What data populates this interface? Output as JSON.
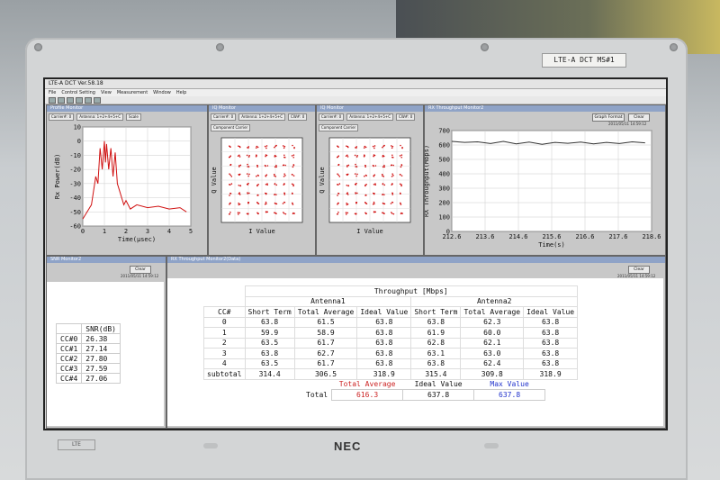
{
  "bezel": {
    "label": "LTE-A DCT MS#1",
    "brand": "NEC",
    "small_label": "LTE"
  },
  "app": {
    "title": "LTE-A DCT Ver.58.18",
    "menu": [
      "File",
      "Control Setting",
      "View",
      "Measurement",
      "Window",
      "Help"
    ]
  },
  "profile_monitor": {
    "title": "Profile Monitor",
    "fields": [
      "Carrier#: 0",
      "Antenna: 1+2+4+5+C",
      "Scale"
    ],
    "chart_data": {
      "type": "line",
      "xlabel": "Time(μsec)",
      "ylabel": "Rx Power(dB)",
      "xlim": [
        0,
        5
      ],
      "ylim": [
        -60,
        10
      ],
      "xticks": [
        "0",
        "1",
        "2",
        "3",
        "4",
        "5"
      ],
      "yticks": [
        "10",
        "0",
        "-10",
        "-20",
        "-30",
        "-40",
        "-50",
        "-60"
      ],
      "x": [
        0.0,
        0.2,
        0.4,
        0.5,
        0.6,
        0.7,
        0.8,
        0.9,
        1.0,
        1.05,
        1.1,
        1.2,
        1.3,
        1.4,
        1.5,
        1.6,
        1.7,
        1.8,
        1.9,
        2.0,
        2.2,
        2.5,
        3.0,
        3.5,
        4.0,
        4.5,
        4.8
      ],
      "y": [
        -55,
        -50,
        -45,
        -35,
        -25,
        -30,
        -5,
        -20,
        0,
        -15,
        -2,
        -20,
        -5,
        -25,
        -8,
        -30,
        -35,
        -40,
        -45,
        -42,
        -48,
        -45,
        -47,
        -46,
        -48,
        -47,
        -50
      ],
      "grid": true
    }
  },
  "iq_monitor_1": {
    "title": "IQ Monitor",
    "fields": [
      "Carrier#: 0",
      "Antenna: 1+2+4+5+C",
      "CW#: 0"
    ],
    "component_label": "Component Carrier",
    "xlabel": "I Value",
    "ylabel": "Q Value"
  },
  "iq_monitor_2": {
    "title": "IQ Monitor",
    "fields": [
      "Carrier#: 0",
      "Antenna: 1+2+4+5+C",
      "CW#: 0"
    ],
    "component_label": "Component Carrier",
    "xlabel": "I Value",
    "ylabel": "Q Value"
  },
  "throughput_monitor": {
    "title": "RX Throughput Monitor2",
    "buttons": [
      "Graph Format",
      "Clear"
    ],
    "date": "2011/05/11 14:59:12",
    "chart_data": {
      "type": "line",
      "xlabel": "Time(s)",
      "ylabel": "RX Throughput(Mbps)",
      "xlim": [
        212.6,
        218.8
      ],
      "ylim": [
        0,
        700
      ],
      "xticks": [
        "212.6",
        "213.6",
        "214.6",
        "215.6",
        "216.6",
        "217.6",
        "218.6"
      ],
      "yticks": [
        "700",
        "600",
        "500",
        "400",
        "300",
        "200",
        "100",
        "0"
      ],
      "x": [
        212.6,
        213.0,
        213.4,
        213.8,
        214.2,
        214.6,
        215.0,
        215.4,
        215.8,
        216.2,
        216.6,
        217.0,
        217.4,
        217.8,
        218.2,
        218.6
      ],
      "y": [
        625,
        618,
        622,
        610,
        625,
        608,
        620,
        605,
        618,
        612,
        620,
        608,
        618,
        610,
        622,
        615
      ],
      "grid": true
    }
  },
  "snr_monitor": {
    "title": "SNR Monitor2",
    "button": "Clear",
    "date": "2011/05/11 14:59:12",
    "header": "SNR(dB)",
    "rows": [
      {
        "cc": "CC#0",
        "value": "26.38"
      },
      {
        "cc": "CC#1",
        "value": "27.14"
      },
      {
        "cc": "CC#2",
        "value": "27.80"
      },
      {
        "cc": "CC#3",
        "value": "27.59"
      },
      {
        "cc": "CC#4",
        "value": "27.06"
      }
    ]
  },
  "throughput_table": {
    "title": "RX Throughput Monitor2(Data)",
    "button": "Clear",
    "date": "2011/05/11 14:59:12",
    "header_main": "Throughput [Mbps]",
    "antenna1": "Antenna1",
    "antenna2": "Antenna2",
    "cc_header": "CC#",
    "cols": [
      "Short Term",
      "Total Average",
      "Ideal Value",
      "Short Term",
      "Total Average",
      "Ideal Value"
    ],
    "rows": [
      [
        "0",
        "63.8",
        "61.5",
        "63.8",
        "63.8",
        "62.3",
        "63.8"
      ],
      [
        "1",
        "59.9",
        "58.9",
        "63.8",
        "61.9",
        "60.0",
        "63.8"
      ],
      [
        "2",
        "63.5",
        "61.7",
        "63.8",
        "62.8",
        "62.1",
        "63.8"
      ],
      [
        "3",
        "63.8",
        "62.7",
        "63.8",
        "63.1",
        "63.0",
        "63.8"
      ],
      [
        "4",
        "63.5",
        "61.7",
        "63.8",
        "63.8",
        "62.4",
        "63.8"
      ],
      [
        "subtotal",
        "314.4",
        "306.5",
        "318.9",
        "315.4",
        "309.8",
        "318.9"
      ]
    ],
    "total_headers": [
      "Total Average",
      "Ideal Value",
      "Max Value"
    ],
    "total_label": "Total",
    "total_values": [
      "616.3",
      "637.8",
      "637.8"
    ],
    "total_colors": [
      "#cc2222",
      "#111111",
      "#2233cc"
    ]
  }
}
